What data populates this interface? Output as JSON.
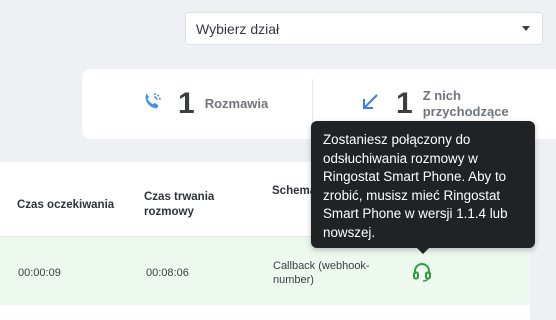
{
  "department_select": {
    "placeholder": "Wybierz dział"
  },
  "stats": {
    "talking": {
      "count": "1",
      "label": "Rozmawia"
    },
    "incoming": {
      "count": "1",
      "label": "Z nich przychodzące"
    }
  },
  "table": {
    "headers": {
      "wait_time": "Czas oczekiwania",
      "call_duration": "Czas trwania rozmowy",
      "scheme": "Schemat przekierowania połączeń"
    },
    "rows": [
      {
        "wait_time": "00:00:09",
        "call_duration": "00:08:06",
        "scheme": "Callback (webhook-number)"
      }
    ]
  },
  "tooltip": {
    "text": "Zostaniesz połączony do odsłuchiwania rozmowy w Ringostat Smart Phone. Aby to zrobić, musisz mieć Ringostat Smart Phone w wersji 1.1.4 lub nowszej."
  },
  "icons": {
    "talking": "phone-ringing-icon",
    "incoming": "incoming-arrow-icon",
    "listen": "headset-icon"
  },
  "colors": {
    "accent_blue": "#4a90e2",
    "listen_green": "#2e9d3e",
    "row_highlight": "#edf8ee"
  }
}
